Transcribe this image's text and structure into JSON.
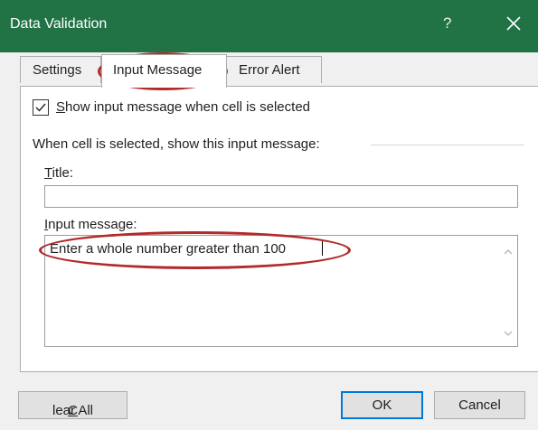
{
  "window": {
    "title": "Data Validation",
    "help_glyph": "?"
  },
  "tabs": [
    {
      "label": "Settings",
      "active": false
    },
    {
      "label": "Input Message",
      "active": true
    },
    {
      "label": "Error Alert",
      "active": false
    }
  ],
  "checkbox": {
    "label_first": "S",
    "label_rest": "how input message when cell is selected",
    "checked": true
  },
  "section": {
    "label": "When cell is selected, show this input message:"
  },
  "title_field": {
    "label_first": "T",
    "label_rest": "itle:",
    "value": ""
  },
  "message_field": {
    "label_first": "I",
    "label_rest": "nput message:",
    "value": "Enter a whole number greater than 100"
  },
  "buttons": {
    "clear_first": "C",
    "clear_rest": "lear All",
    "ok": "OK",
    "cancel": "Cancel"
  },
  "colors": {
    "titlebar": "#217346",
    "highlight_oval": "#b32a2a"
  }
}
